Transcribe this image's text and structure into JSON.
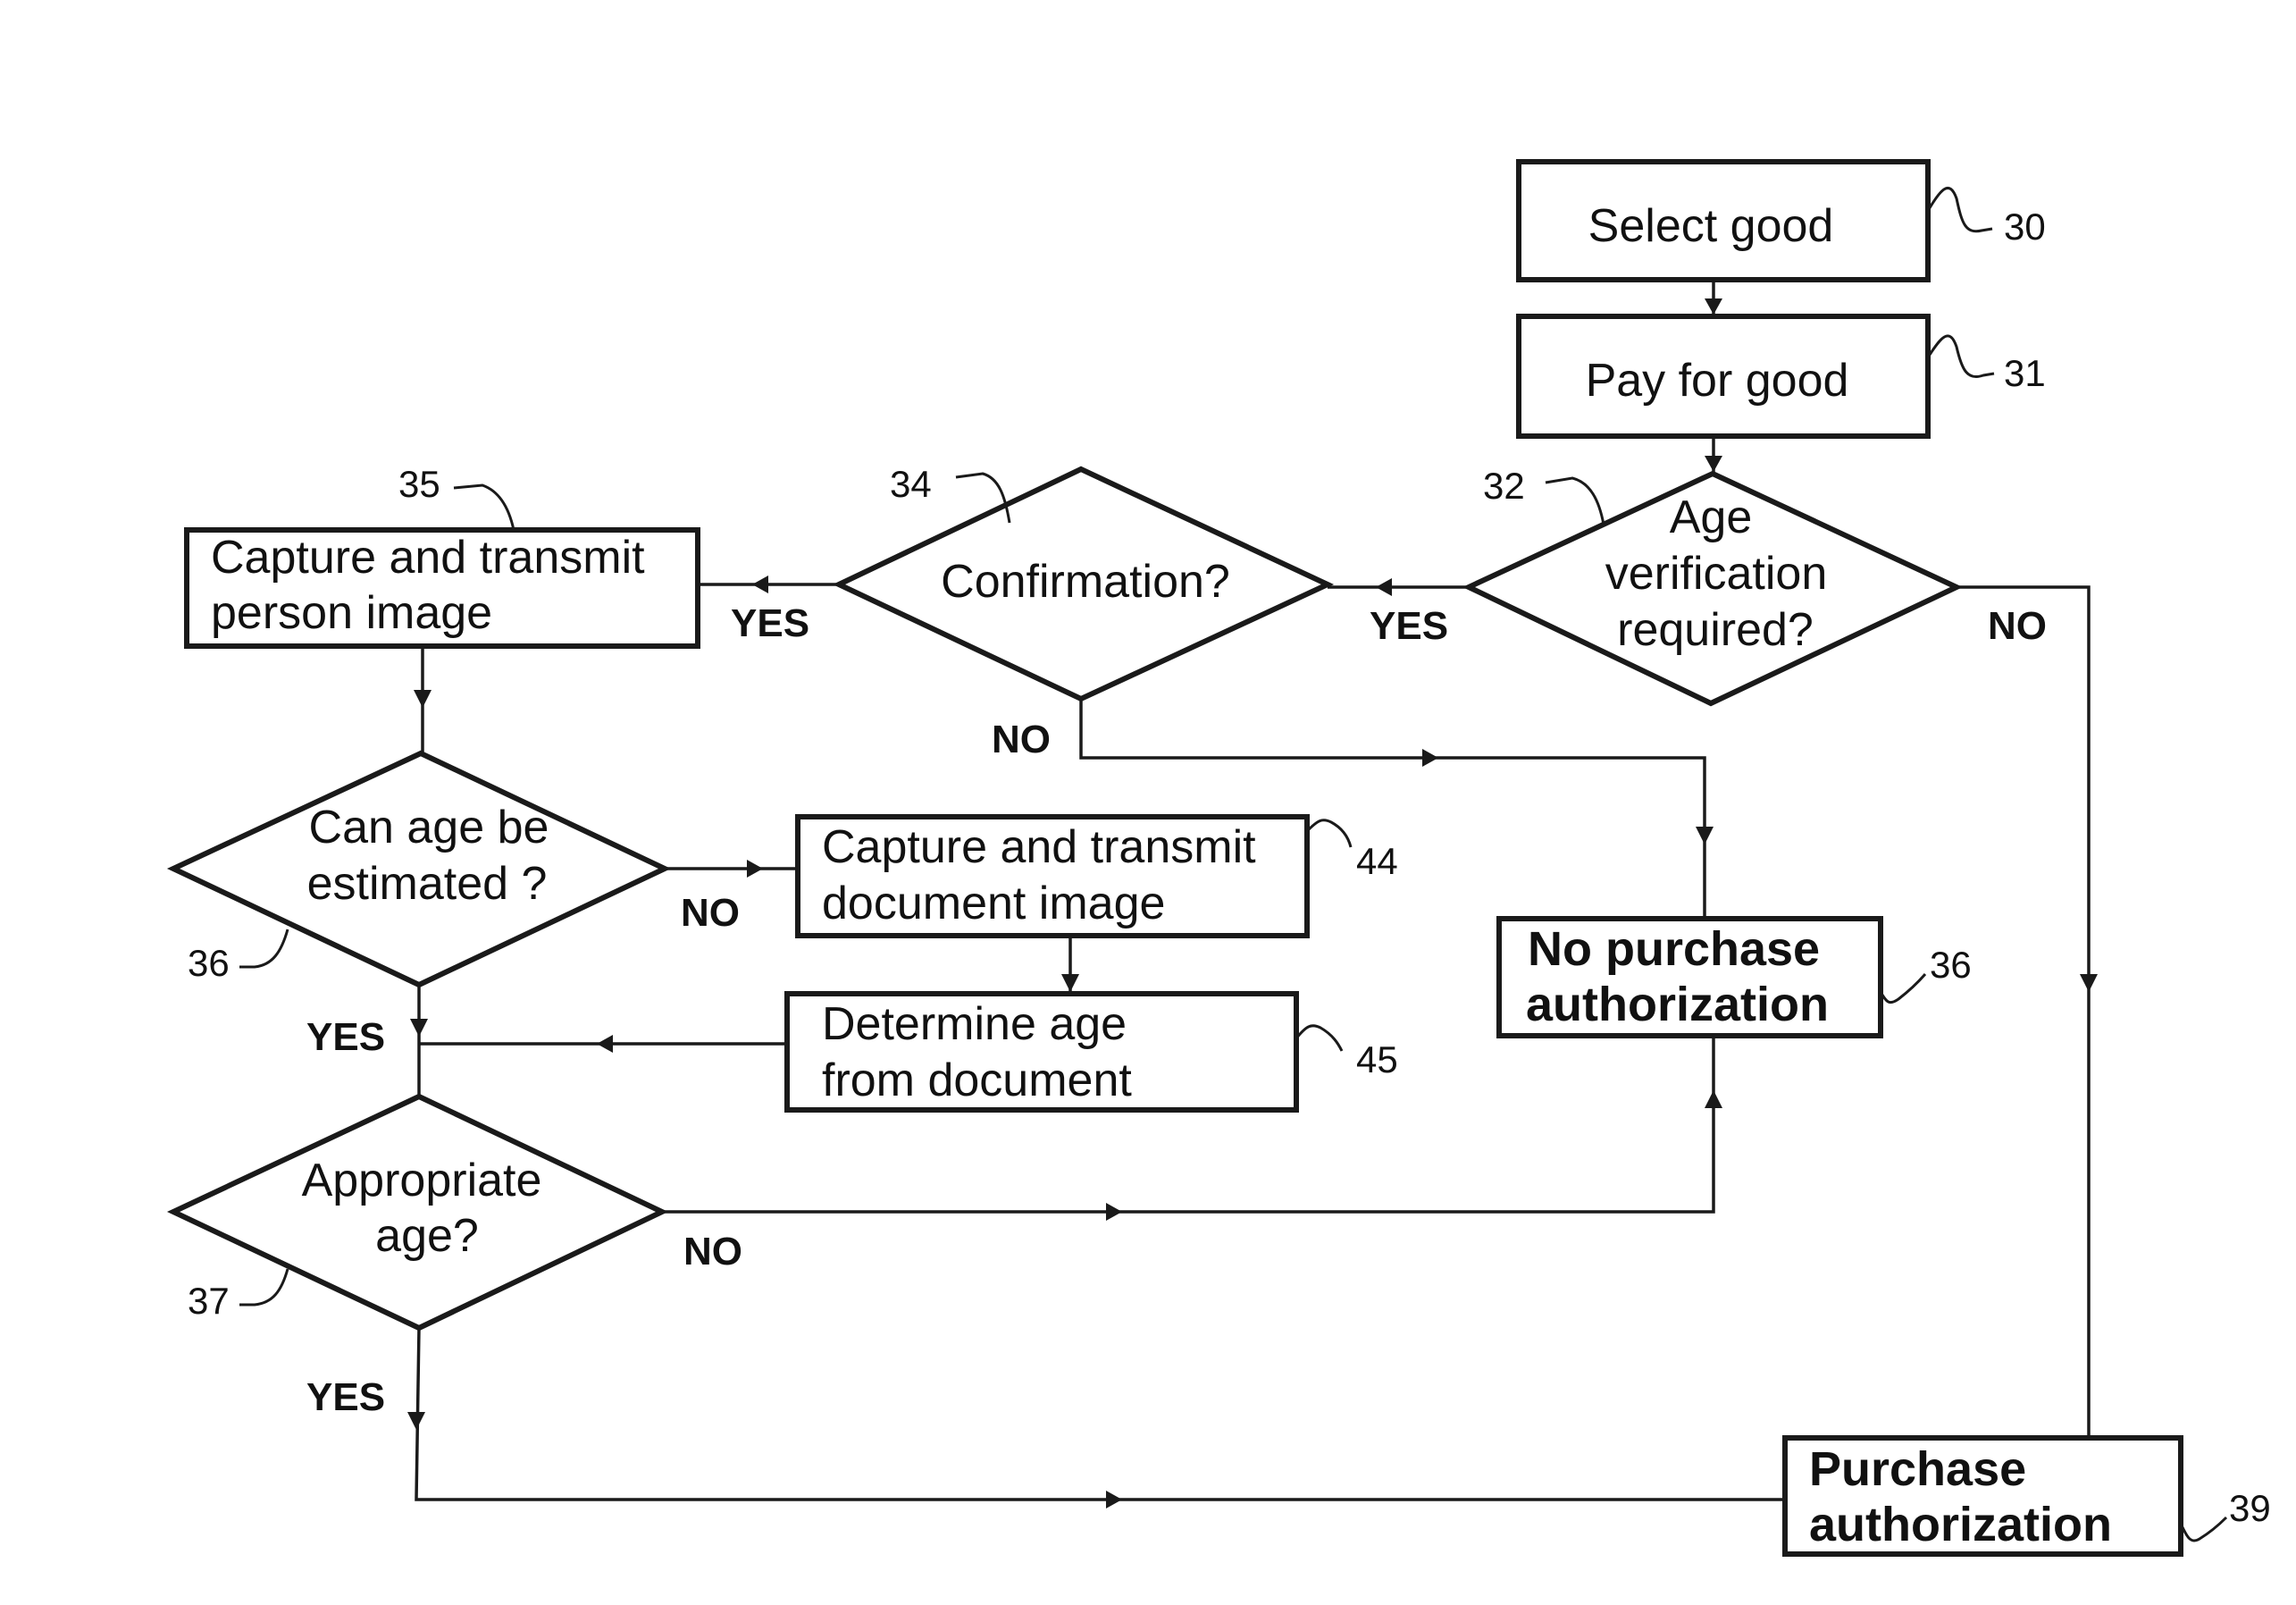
{
  "diagram": {
    "type": "flowchart",
    "nodes": {
      "select_good": {
        "label": [
          "Select good"
        ],
        "ref": "30",
        "shape": "process"
      },
      "pay_for_good": {
        "label": [
          "Pay for good"
        ],
        "ref": "31",
        "shape": "process"
      },
      "age_verification": {
        "label": [
          "Age",
          "verification",
          "required?"
        ],
        "ref": "32",
        "shape": "decision"
      },
      "confirmation": {
        "label": [
          "Confirmation?"
        ],
        "ref": "34",
        "shape": "decision"
      },
      "capture_person": {
        "label": [
          "Capture and transmit",
          "person image"
        ],
        "ref": "35",
        "shape": "process"
      },
      "can_age_be_estimated": {
        "label": [
          "Can age be",
          "estimated ?"
        ],
        "ref": "36",
        "shape": "decision"
      },
      "capture_document": {
        "label": [
          "Capture and transmit",
          "document image"
        ],
        "ref": "44",
        "shape": "process"
      },
      "determine_age": {
        "label": [
          "Determine age",
          "from document"
        ],
        "ref": "45",
        "shape": "process"
      },
      "no_purchase": {
        "label": [
          "No purchase",
          "authorization"
        ],
        "ref": "36",
        "shape": "terminal"
      },
      "appropriate_age": {
        "label": [
          "Appropriate",
          "age?"
        ],
        "ref": "37",
        "shape": "decision"
      },
      "purchase_auth": {
        "label": [
          "Purchase",
          "authorization"
        ],
        "ref": "39",
        "shape": "terminal"
      }
    },
    "edge_labels": {
      "age_yes": "YES",
      "age_no": "NO",
      "confirm_yes": "YES",
      "confirm_no": "NO",
      "estimate_no": "NO",
      "estimate_yes": "YES",
      "appropriate_no": "NO",
      "appropriate_yes": "YES"
    },
    "edges": [
      {
        "from": "select_good",
        "to": "pay_for_good"
      },
      {
        "from": "pay_for_good",
        "to": "age_verification"
      },
      {
        "from": "age_verification",
        "to": "confirmation",
        "label": "YES"
      },
      {
        "from": "age_verification",
        "to": "purchase_auth",
        "label": "NO"
      },
      {
        "from": "confirmation",
        "to": "capture_person",
        "label": "YES"
      },
      {
        "from": "confirmation",
        "to": "no_purchase",
        "label": "NO"
      },
      {
        "from": "capture_person",
        "to": "can_age_be_estimated"
      },
      {
        "from": "can_age_be_estimated",
        "to": "capture_document",
        "label": "NO"
      },
      {
        "from": "can_age_be_estimated",
        "to": "appropriate_age",
        "label": "YES"
      },
      {
        "from": "capture_document",
        "to": "determine_age"
      },
      {
        "from": "determine_age",
        "to": "appropriate_age"
      },
      {
        "from": "appropriate_age",
        "to": "no_purchase",
        "label": "NO"
      },
      {
        "from": "appropriate_age",
        "to": "purchase_auth",
        "label": "YES"
      }
    ]
  }
}
